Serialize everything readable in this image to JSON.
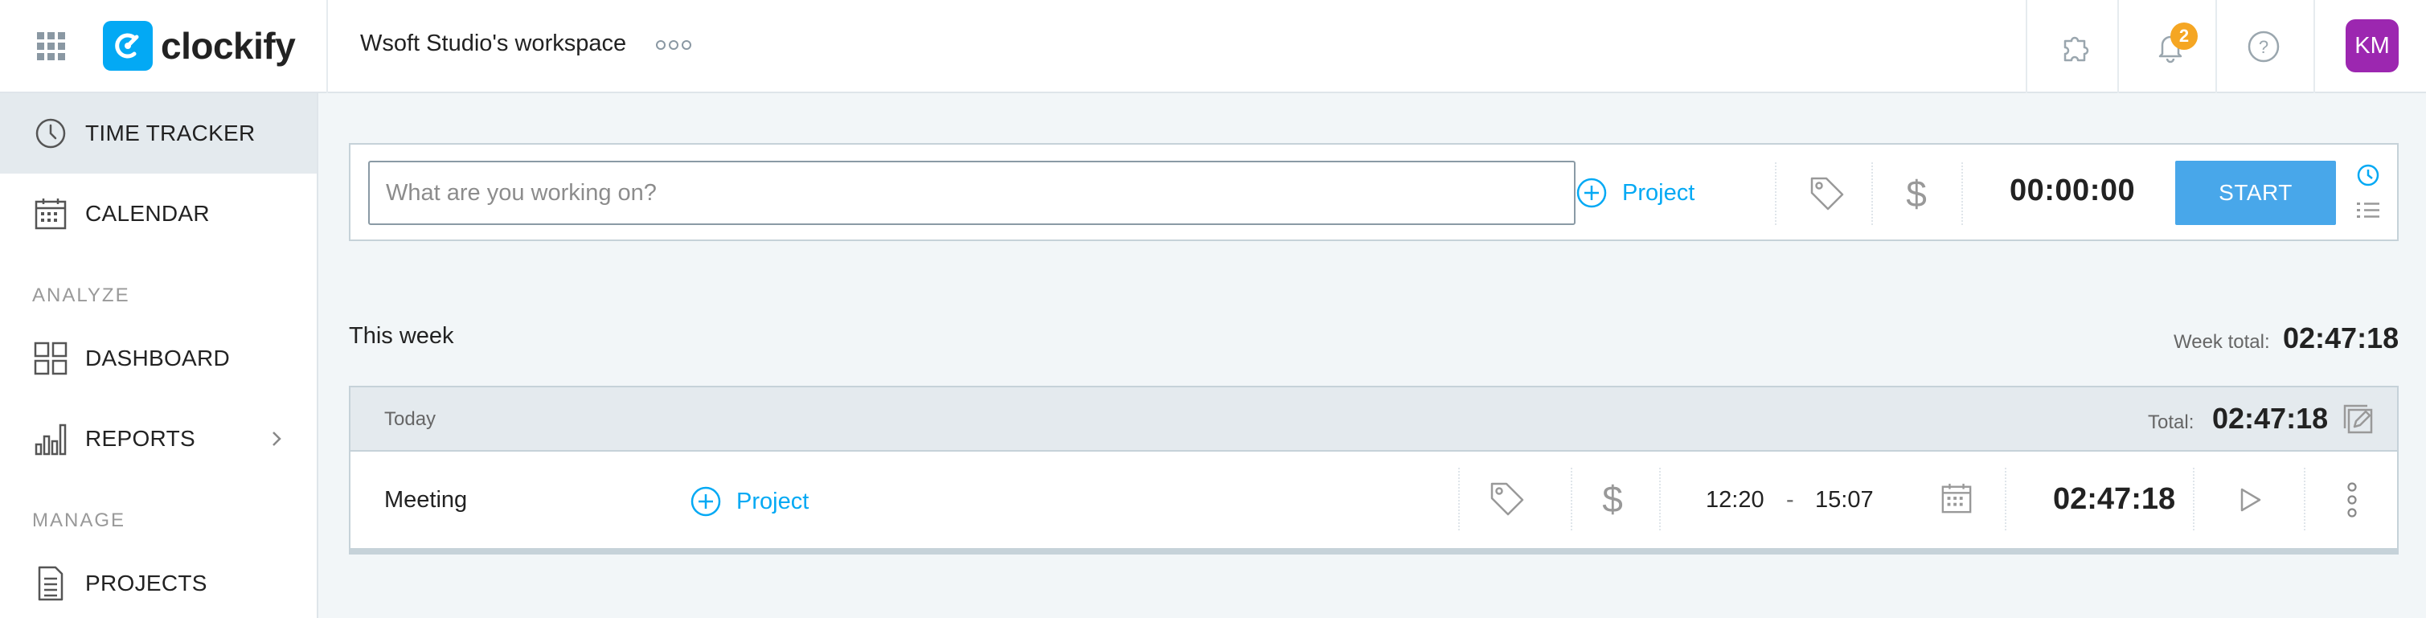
{
  "app": {
    "name": "clockify",
    "workspace": "Wsoft Studio's workspace"
  },
  "header": {
    "notification_count": "2",
    "avatar_initials": "KM",
    "accent": "#03a9f4",
    "avatar_color": "#9c27b0"
  },
  "sidebar": {
    "items": [
      {
        "label": "TIME TRACKER",
        "icon": "clock-icon",
        "active": true
      },
      {
        "label": "CALENDAR",
        "icon": "calendar-icon"
      },
      {
        "label": "DASHBOARD",
        "icon": "dashboard-icon"
      },
      {
        "label": "REPORTS",
        "icon": "bar-chart-icon"
      },
      {
        "label": "PROJECTS",
        "icon": "document-icon"
      }
    ],
    "sections": {
      "analyze": "ANALYZE",
      "manage": "MANAGE"
    }
  },
  "tracker": {
    "placeholder": "What are you working on?",
    "project_label": "Project",
    "timer": "00:00:00",
    "start_label": "START"
  },
  "week": {
    "label": "This week",
    "total_label": "Week total:",
    "total": "02:47:18"
  },
  "group": {
    "label": "Today",
    "total_label": "Total:",
    "total": "02:47:18",
    "entries": [
      {
        "description": "Meeting",
        "project_label": "Project",
        "start": "12:20",
        "separator": "-",
        "end": "15:07",
        "duration": "02:47:18"
      }
    ]
  }
}
